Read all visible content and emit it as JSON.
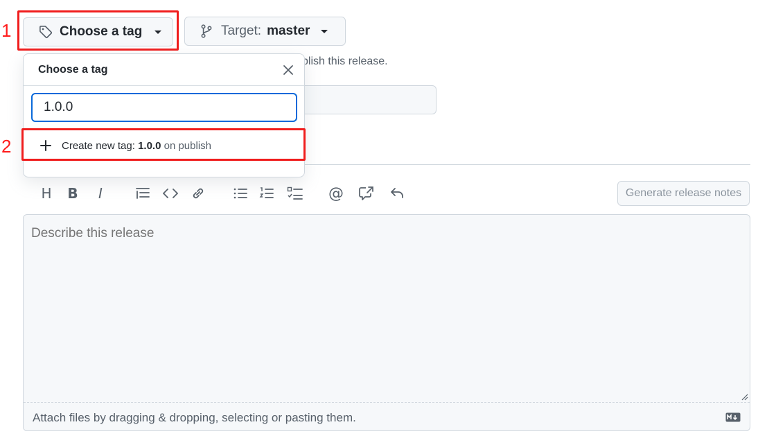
{
  "markers": {
    "one": "1",
    "two": "2"
  },
  "tag_button": {
    "label": "Choose a tag",
    "icon": "tag-icon"
  },
  "target_button": {
    "prefix": "Target:",
    "branch": "master",
    "icon": "git-branch-icon"
  },
  "hint_text": "blish this release.",
  "tag_dropdown": {
    "title": "Choose a tag",
    "search_value": "1.0.0",
    "create_row": {
      "prefix": "Create new tag: ",
      "tag": "1.0.0",
      "suffix": " on publish"
    }
  },
  "toolbar": {
    "buttons": [
      {
        "name": "heading",
        "glyph": "H"
      },
      {
        "name": "bold",
        "glyph": "B"
      },
      {
        "name": "italic",
        "glyph": "I"
      },
      {
        "name": "quote",
        "glyph": ""
      },
      {
        "name": "code",
        "glyph": "<>"
      },
      {
        "name": "link",
        "glyph": ""
      },
      {
        "name": "unordered-list",
        "glyph": ""
      },
      {
        "name": "ordered-list",
        "glyph": ""
      },
      {
        "name": "task-list",
        "glyph": ""
      },
      {
        "name": "mention",
        "glyph": "@"
      },
      {
        "name": "reference",
        "glyph": ""
      },
      {
        "name": "undo",
        "glyph": ""
      }
    ],
    "generate_label": "Generate release notes"
  },
  "editor": {
    "placeholder": "Describe this release",
    "footer": "Attach files by dragging & dropping, selecting or pasting them."
  },
  "colors": {
    "annotation": "#f01d1d",
    "focus": "#0969da",
    "muted": "#57606a"
  }
}
